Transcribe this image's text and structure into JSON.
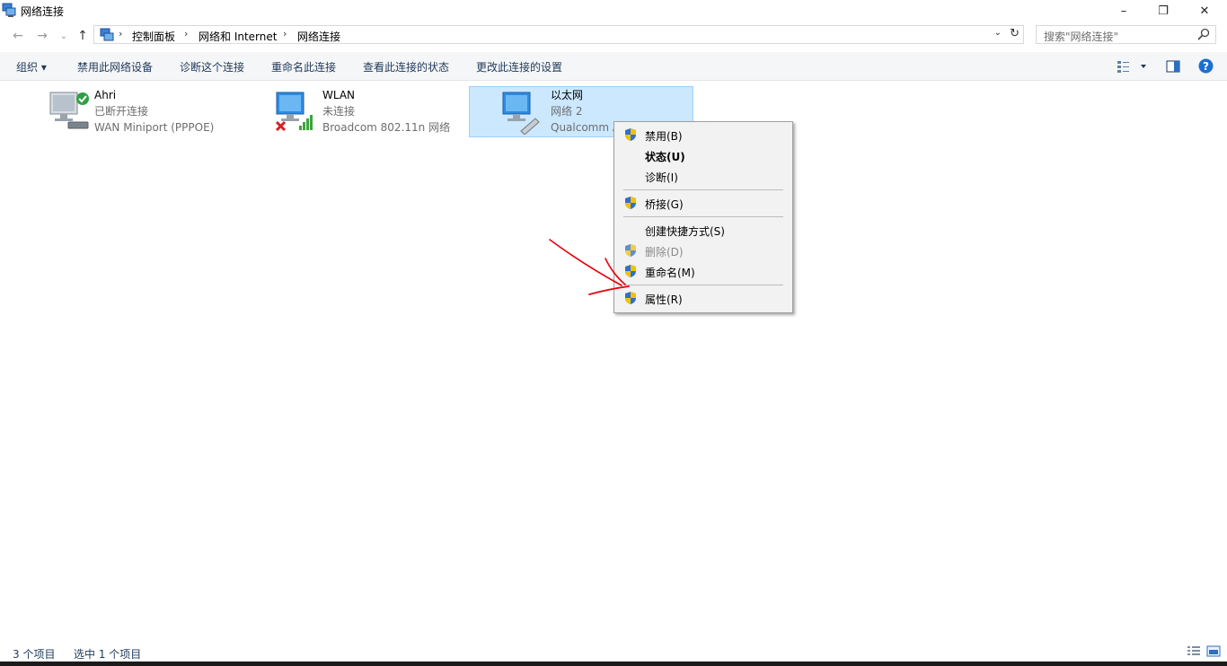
{
  "window": {
    "title": "网络连接",
    "minimize": "–",
    "maximize": "❐",
    "close": "✕"
  },
  "nav": {
    "back": "←",
    "forward": "→",
    "recent": "⌄",
    "up": "↑"
  },
  "address": {
    "crumbs": [
      "控制面板",
      "网络和 Internet",
      "网络连接"
    ],
    "sep": "›",
    "dropdown": "⌄",
    "refresh": "↻"
  },
  "search": {
    "placeholder": "搜索\"网络连接\""
  },
  "commands": {
    "organize": "组织 ▾",
    "disable": "禁用此网络设备",
    "diagnose": "诊断这个连接",
    "rename": "重命名此连接",
    "status": "查看此连接的状态",
    "settings": "更改此连接的设置"
  },
  "connections": [
    {
      "name": "Ahri",
      "status": "已断开连接",
      "device": "WAN Miniport (PPPOE)"
    },
    {
      "name": "WLAN",
      "status": "未连接",
      "device": "Broadcom 802.11n 网络"
    },
    {
      "name": "以太网",
      "status": "网络 2",
      "device": "Qualcomm A"
    }
  ],
  "context_menu": {
    "disable": "禁用(B)",
    "status": "状态(U)",
    "diagnose": "诊断(I)",
    "bridge": "桥接(G)",
    "shortcut": "创建快捷方式(S)",
    "delete": "删除(D)",
    "rename": "重命名(M)",
    "properties": "属性(R)"
  },
  "statusbar": {
    "count": "3 个项目",
    "selected": "选中 1 个项目"
  },
  "colors": {
    "accent": "#1e395b",
    "selection": "#cce8ff",
    "annotation": "#e8000b"
  }
}
